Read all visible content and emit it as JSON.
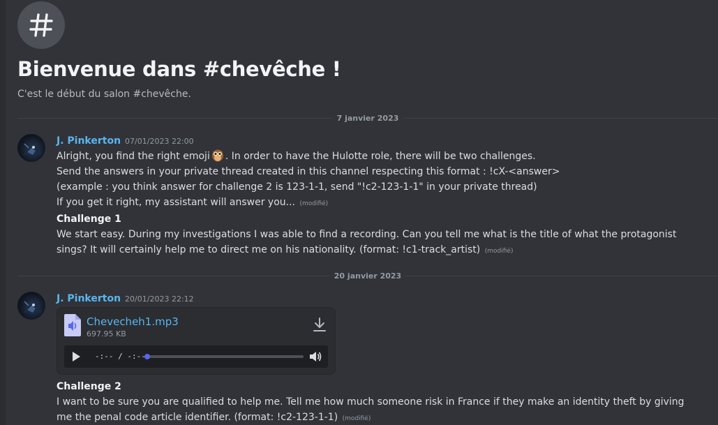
{
  "welcome": {
    "channel_icon": "hashtag-icon",
    "title": "Bienvenue dans #chevêche !",
    "subtitle": "C'est le début du salon #chevêche."
  },
  "dividers": [
    "7 janvier 2023",
    "20 janvier 2023"
  ],
  "messages": [
    {
      "author": "J. Pinkerton",
      "timestamp": "07/01/2023 22:00",
      "intro_before_emoji": "Alright, you find the right emoji",
      "emoji": "owl-emoji",
      "intro_after_emoji": ". In order to have the Hulotte role, there will be two challenges.",
      "line2": "Send the answers in your private thread created in this channel respecting this format : !cX-<answer>",
      "line3": "(example : you think answer for challenge 2 is 123-1-1, send \"!c2-123-1-1\" in your private thread)",
      "line4": "If you get it right, my assistant will answer you...",
      "edited1": "(modifié)",
      "challenge_title": "Challenge 1",
      "challenge_text": "We start easy. During my investigations I was able to find a recording. Can you tell me what is the title of what the protagonist sings? It will certainly help me to direct me on his nationality. (format: !c1-track_artist)",
      "edited2": "(modifié)"
    },
    {
      "author": "J. Pinkerton",
      "timestamp": "20/01/2023 22:12",
      "attachment": {
        "file_name": "Chevecheh1.mp3",
        "file_size": "697.95 KB",
        "player_time": "-:-- / -:--",
        "progress": 0
      },
      "challenge_title": "Challenge 2",
      "challenge_text": "I want to be sure you are qualified to help me. Tell me how much someone risk in France if they make an identity theft by giving me the penal code article identifier. (format: !c2-123-1-1)",
      "edited": "(modifié)"
    }
  ],
  "colors": {
    "background": "#313338",
    "author": "#59b6f0",
    "accent": "#5865f2",
    "muted": "#949ba4"
  }
}
